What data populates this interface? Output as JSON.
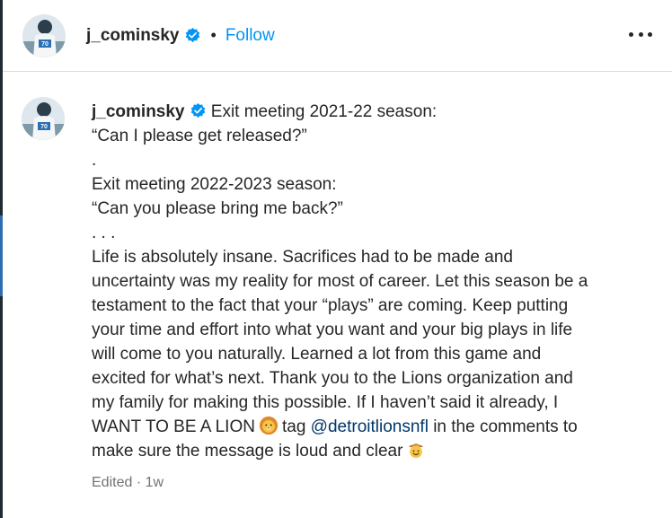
{
  "post_header": {
    "username": "j_cominsky",
    "separator": "•",
    "follow_label": "Follow"
  },
  "caption": {
    "username": "j_cominsky",
    "first_line": "Exit meeting 2021-22 season:",
    "lines": [
      "“Can I please get released?”",
      ".",
      "Exit meeting 2022-2023 season:",
      "“Can you please bring me back?”",
      ". . .",
      "Life is absolutely insane. Sacrifices had to be made and",
      "uncertainty was my reality for most of career. Let this season be a",
      "testament to the fact that your “plays” are coming. Keep putting",
      "your time and effort into what you want and your big plays in life",
      "will come to you naturally. Learned a lot from this game and",
      "excited for what’s next. Thank you to the Lions organization and",
      "my family for making this possible. If I haven’t said it already, I"
    ],
    "lion_line_before": "WANT TO BE A LION",
    "lion_line_tag": "tag",
    "mention": "@detroitlionsnfl",
    "lion_line_after": "in the comments to",
    "last_line": "make sure the message is loud and clear",
    "edited_label": "Edited",
    "dot": "·",
    "age": "1w"
  },
  "icons": {
    "verified": "verified-badge-icon",
    "lion": "lion-face-emoji",
    "cowboy": "cowboy-face-emoji",
    "more": "more-options-icon"
  },
  "colors": {
    "accent": "#0095f6",
    "verified": "#0095f6",
    "mention": "#00376b",
    "muted": "#737373"
  }
}
